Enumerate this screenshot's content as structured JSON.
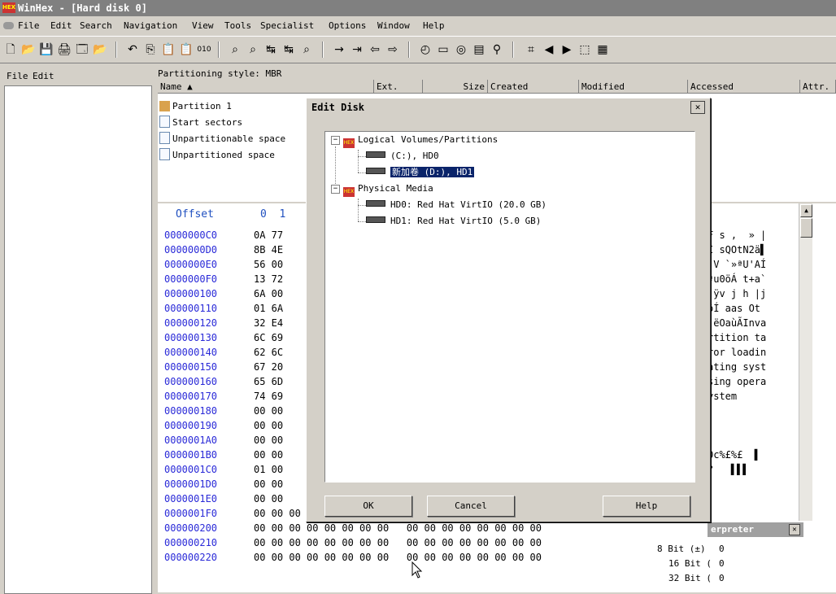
{
  "window": {
    "title": "WinHex - [Hard disk 0]",
    "app_icon": "HEX"
  },
  "menubar": [
    "File",
    "Edit",
    "Search",
    "Navigation",
    "View",
    "Tools",
    "Specialist",
    "Options",
    "Window",
    "Help"
  ],
  "toolbar": {
    "icons": [
      "new-file-icon",
      "open-folder-icon",
      "save-icon",
      "print-icon",
      "properties-icon",
      "open-folder-icon",
      "undo-icon",
      "copy-icon",
      "paste-icon",
      "paste-special-icon",
      "copy-hex-icon",
      "find-binoculars-icon",
      "find-hex-icon",
      "replace-icon",
      "replace-hex-icon",
      "find-again-icon",
      "goto-offset-icon",
      "goto-sector-icon",
      "back-icon",
      "forward-icon",
      "disk-editor-icon",
      "ram-editor-icon",
      "disk-icon",
      "calculator-icon",
      "search-icon",
      "checksum-icon",
      "arrow-left-icon",
      "arrow-right-icon",
      "camera-icon",
      "view-icon"
    ],
    "glyphs": [
      "🗋",
      "📂",
      "💾",
      "🖨",
      "🗔",
      "📂",
      "↶",
      "⎘",
      "📋",
      "📋",
      "010",
      "⌕",
      "⌕",
      "↹",
      "↹",
      "⌕",
      "→",
      "⇥",
      "⇦",
      "⇨",
      "◴",
      "▭",
      "◎",
      "▤",
      "⚲",
      "⌗",
      "◀",
      "▶",
      "⬚",
      "▦"
    ]
  },
  "left_pane": {
    "menu": [
      "File",
      "Edit"
    ]
  },
  "partitioning": {
    "title": "Partitioning style: MBR",
    "columns": [
      "Name ▲",
      "Ext.",
      "Size",
      "Created",
      "Modified",
      "Accessed",
      "Attr."
    ],
    "rows": [
      "Partition 1",
      "Start sectors",
      "Unpartitionable space",
      "Unpartitioned space"
    ]
  },
  "hex": {
    "header_offset": "Offset",
    "header_cols": "0  1",
    "rows": [
      {
        "offset": "0000000C0",
        "hex": "0A 77",
        "ascii": "F s ,  » |"
      },
      {
        "offset": "0000000D0",
        "hex": "8B 4E",
        "ascii": "Í sQOtN2ä▌"
      },
      {
        "offset": "0000000E0",
        "hex": "56 00",
        "ascii": "▌V `»ªU'AÍ"
      },
      {
        "offset": "0000000F0",
        "hex": "13 72",
        "ascii": "ªu0öÁ t+a`"
      },
      {
        "offset": "000000100",
        "hex": "6A 00",
        "ascii": " ÿv j h |j"
      },
      {
        "offset": "000000110",
        "hex": "01 6A",
        "ascii": "ôÍ aas Ot"
      },
      {
        "offset": "000000120",
        "hex": "32 E4",
        "ascii": " ëOaùÃInva"
      },
      {
        "offset": "000000130",
        "hex": "6C 69",
        "ascii": "rtition ta"
      },
      {
        "offset": "000000140",
        "hex": "62 6C",
        "ascii": "ror loadin"
      },
      {
        "offset": "000000150",
        "hex": "67 20",
        "ascii": "ating syst"
      },
      {
        "offset": "000000160",
        "hex": "65 6D",
        "ascii": "sing opera"
      },
      {
        "offset": "000000170",
        "hex": "74 69",
        "ascii": "ystem"
      },
      {
        "offset": "000000180",
        "hex": "00 00",
        "ascii": ""
      },
      {
        "offset": "000000190",
        "hex": "00 00",
        "ascii": ""
      },
      {
        "offset": "0000001A0",
        "hex": "00 00",
        "ascii": ""
      },
      {
        "offset": "0000001B0",
        "hex": "00 00",
        "ascii": "Oc%£%£  ▌"
      },
      {
        "offset": "0000001C0",
        "hex": "01 00",
        "ascii": "?   ▌▌▌"
      },
      {
        "offset": "0000001D0",
        "hex": "00 00",
        "ascii": ""
      },
      {
        "offset": "0000001E0",
        "hex": "00 00",
        "ascii": ""
      },
      {
        "offset": "0000001F0",
        "hex": "00 00 00 00 00 00 00 00   00 00 00 00 00 00 55 AA",
        "ascii": ""
      },
      {
        "offset": "000000200",
        "hex": "00 00 00 00 00 00 00 00   00 00 00 00 00 00 00 00",
        "ascii": ""
      },
      {
        "offset": "000000210",
        "hex": "00 00 00 00 00 00 00 00   00 00 00 00 00 00 00 00",
        "ascii": ""
      },
      {
        "offset": "000000220",
        "hex": "00 00 00 00 00 00 00 00   00 00 00 00 00 00 00 00",
        "ascii": ""
      }
    ]
  },
  "interpreter": {
    "title": "Data Interpreter",
    "title_visible": "erpreter",
    "rows": [
      {
        "label": "8 Bit (±)",
        "value": "0"
      },
      {
        "label": "16 Bit (",
        "value": "0"
      },
      {
        "label": "32 Bit (",
        "value": "0"
      }
    ]
  },
  "dialog": {
    "title": "Edit Disk",
    "close": "✕",
    "tree": {
      "logical_root": "Logical Volumes/Partitions",
      "logical": [
        "(C:), HD0",
        "新加卷 (D:), HD1"
      ],
      "physical_root": "Physical Media",
      "physical": [
        "HD0: Red Hat VirtIO (20.0 GB)",
        "HD1: Red Hat VirtIO (5.0 GB)"
      ]
    },
    "buttons": {
      "ok": "OK",
      "cancel": "Cancel",
      "help": "Help"
    }
  },
  "colors": {
    "selection": "#0a246a",
    "offset_text": "#2a2ad8",
    "titlebar": "#808080"
  }
}
